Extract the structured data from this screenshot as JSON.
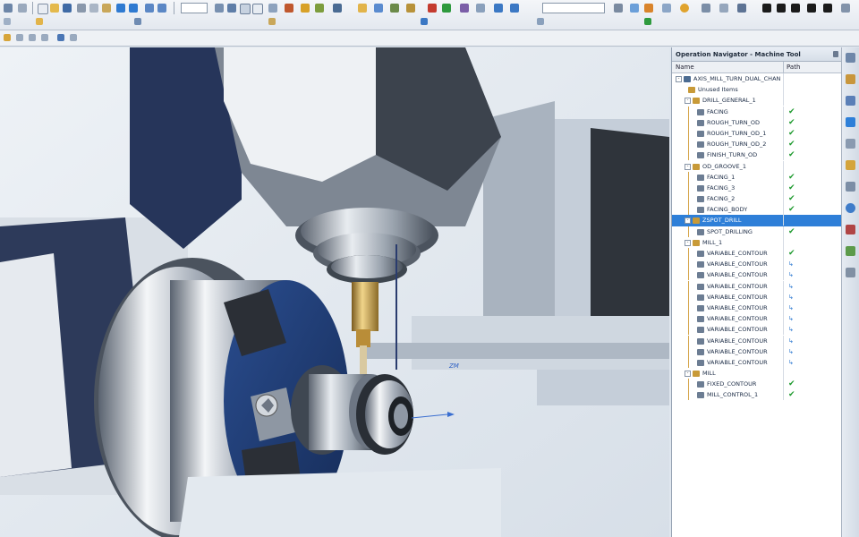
{
  "toolbar": {
    "zoom_combo": "",
    "filter_combo": ""
  },
  "navigator": {
    "title": "Operation Navigator - Machine Tool",
    "col_name": "Name",
    "col_path": "Path",
    "rows": [
      {
        "label": "AXIS_MILL_TURN_DUAL_CHANNEL",
        "indent": 0,
        "kind": "root",
        "expander": "-",
        "check": ""
      },
      {
        "label": "Unused Items",
        "indent": 1,
        "kind": "folder",
        "expander": "",
        "check": ""
      },
      {
        "label": "DRILL_GENERAL_1",
        "indent": 1,
        "kind": "folder",
        "expander": "-",
        "check": ""
      },
      {
        "label": "FACING",
        "indent": 2,
        "kind": "op",
        "expander": "",
        "check": "✔"
      },
      {
        "label": "ROUGH_TURN_OD",
        "indent": 2,
        "kind": "op",
        "expander": "",
        "check": "✔"
      },
      {
        "label": "ROUGH_TURN_OD_1",
        "indent": 2,
        "kind": "op",
        "expander": "",
        "check": "✔"
      },
      {
        "label": "ROUGH_TURN_OD_2",
        "indent": 2,
        "kind": "op",
        "expander": "",
        "check": "✔"
      },
      {
        "label": "FINISH_TURN_OD",
        "indent": 2,
        "kind": "op",
        "expander": "",
        "check": "✔"
      },
      {
        "label": "OD_GROOVE_1",
        "indent": 1,
        "kind": "folder",
        "expander": "-",
        "check": ""
      },
      {
        "label": "FACING_1",
        "indent": 2,
        "kind": "op",
        "expander": "",
        "check": "✔"
      },
      {
        "label": "FACING_3",
        "indent": 2,
        "kind": "op",
        "expander": "",
        "check": "✔"
      },
      {
        "label": "FACING_2",
        "indent": 2,
        "kind": "op",
        "expander": "",
        "check": "✔"
      },
      {
        "label": "FACING_BODY",
        "indent": 2,
        "kind": "op",
        "expander": "",
        "check": "✔"
      },
      {
        "label": "ZSPOT_DRILL",
        "indent": 1,
        "kind": "folder",
        "expander": "-",
        "check": "",
        "selected": true
      },
      {
        "label": "SPOT_DRILLING",
        "indent": 2,
        "kind": "op",
        "expander": "",
        "check": "✔"
      },
      {
        "label": "MILL_1",
        "indent": 1,
        "kind": "folder",
        "expander": "-",
        "check": ""
      },
      {
        "label": "VARIABLE_CONTOUR",
        "indent": 2,
        "kind": "op",
        "expander": "",
        "check": "✔"
      },
      {
        "label": "VARIABLE_CONTOUR",
        "indent": 2,
        "kind": "op",
        "expander": "",
        "check": "↳"
      },
      {
        "label": "VARIABLE_CONTOUR",
        "indent": 2,
        "kind": "op",
        "expander": "",
        "check": "↳"
      },
      {
        "label": "VARIABLE_CONTOUR",
        "indent": 2,
        "kind": "op",
        "expander": "",
        "check": "↳"
      },
      {
        "label": "VARIABLE_CONTOUR",
        "indent": 2,
        "kind": "op",
        "expander": "",
        "check": "↳"
      },
      {
        "label": "VARIABLE_CONTOUR",
        "indent": 2,
        "kind": "op",
        "expander": "",
        "check": "↳"
      },
      {
        "label": "VARIABLE_CONTOUR",
        "indent": 2,
        "kind": "op",
        "expander": "",
        "check": "↳"
      },
      {
        "label": "VARIABLE_CONTOUR",
        "indent": 2,
        "kind": "op",
        "expander": "",
        "check": "↳"
      },
      {
        "label": "VARIABLE_CONTOUR",
        "indent": 2,
        "kind": "op",
        "expander": "",
        "check": "↳"
      },
      {
        "label": "VARIABLE_CONTOUR",
        "indent": 2,
        "kind": "op",
        "expander": "",
        "check": "↳"
      },
      {
        "label": "VARIABLE_CONTOUR",
        "indent": 2,
        "kind": "op",
        "expander": "",
        "check": "↳"
      },
      {
        "label": "MILL",
        "indent": 1,
        "kind": "folder",
        "expander": "-",
        "check": ""
      },
      {
        "label": "FIXED_CONTOUR",
        "indent": 2,
        "kind": "op",
        "expander": "",
        "check": "✔"
      },
      {
        "label": "MILL_CONTROL_1",
        "indent": 2,
        "kind": "op",
        "expander": "",
        "check": "✔"
      }
    ]
  },
  "viewport": {
    "axis_label": "ZM"
  },
  "colors": {
    "selection": "#2e7fd8",
    "check": "#1e9a2e",
    "chuck_blue": "#1f3f7a",
    "machine_gray": "#8c96a3"
  }
}
